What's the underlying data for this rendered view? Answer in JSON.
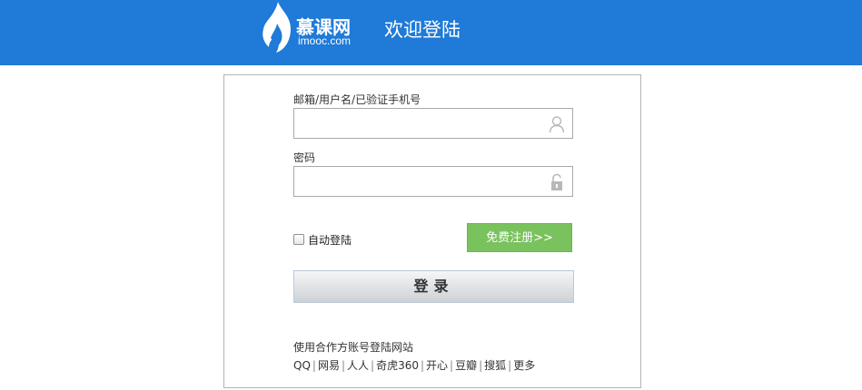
{
  "header": {
    "logo_cn": "慕课网",
    "logo_en": "imooc.com",
    "welcome": "欢迎登陆",
    "bg_color": "#1f7ad8"
  },
  "form": {
    "username_label": "邮箱/用户名/已验证手机号",
    "username_value": "",
    "username_icon": "user-icon",
    "password_label": "密码",
    "password_value": "",
    "password_icon": "lock-icon",
    "auto_login_label": "自动登陆",
    "auto_login_checked": false,
    "register_label": "免费注册>>",
    "register_color": "#79c25d",
    "login_label": "登录"
  },
  "partners": {
    "title": "使用合作方账号登陆网站",
    "items": [
      "QQ",
      "网易",
      "人人",
      "奇虎360",
      "开心",
      "豆瓣",
      "搜狐",
      "更多"
    ]
  }
}
